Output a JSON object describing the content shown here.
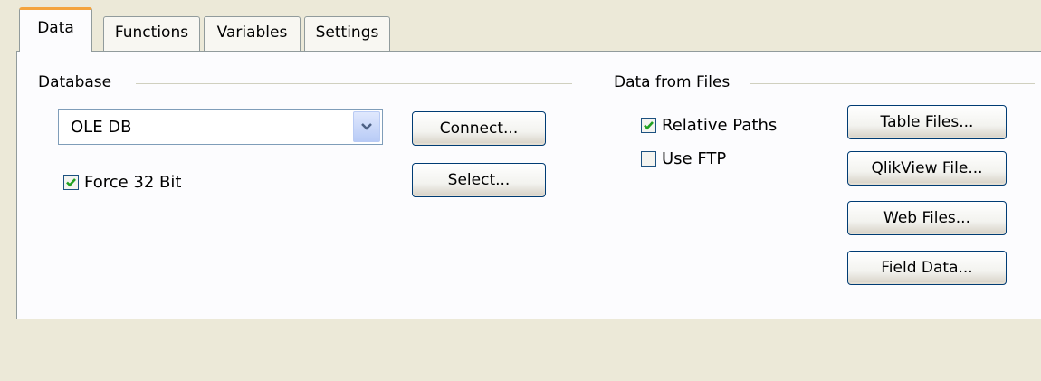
{
  "tabs": [
    {
      "label": "Data",
      "active": true
    },
    {
      "label": "Functions",
      "active": false
    },
    {
      "label": "Variables",
      "active": false
    },
    {
      "label": "Settings",
      "active": false
    }
  ],
  "database": {
    "group_label": "Database",
    "selected_value": "OLE DB",
    "force32_label": "Force 32 Bit",
    "force32_checked": true,
    "connect_label": "Connect...",
    "select_label": "Select..."
  },
  "files": {
    "group_label": "Data from Files",
    "relative_paths_label": "Relative Paths",
    "relative_paths_checked": true,
    "use_ftp_label": "Use FTP",
    "use_ftp_checked": false,
    "buttons": [
      {
        "label": "Table Files..."
      },
      {
        "label": "QlikView File..."
      },
      {
        "label": "Web Files..."
      },
      {
        "label": "Field Data..."
      }
    ]
  },
  "colors": {
    "check": "#21a121",
    "tab_highlight": "#f4a33c",
    "button_border": "#003c74"
  }
}
